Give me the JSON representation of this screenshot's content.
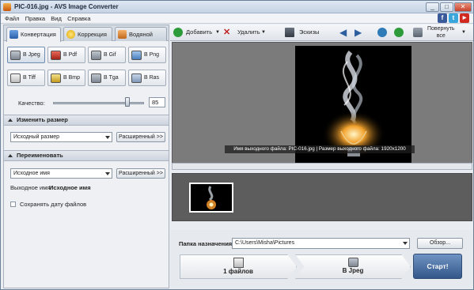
{
  "window": {
    "title": "PIC-016.jpg - AVS Image Converter",
    "min": "_",
    "max": "□",
    "close": "✕"
  },
  "menu": [
    "Файл",
    "Правка",
    "Вид",
    "Справка"
  ],
  "social": {
    "facebook": "f",
    "twitter": "t",
    "youtube": "▶"
  },
  "tabs": [
    "Конвертация",
    "Коррекция",
    "Водяной знак"
  ],
  "formats": [
    "В Jpeg",
    "В Pdf",
    "В Gif",
    "В Png",
    "В Tiff",
    "В Bmp",
    "В Tga",
    "В Ras"
  ],
  "quality": {
    "label": "Качество:",
    "value": "85",
    "level": 0.85
  },
  "resize": {
    "header": "Изменить размер",
    "select": "Исходный размер",
    "advanced": "Расширенный >>"
  },
  "rename": {
    "header": "Переименовать",
    "select": "Исходное имя",
    "advanced": "Расширенный >>",
    "output_label": "Выходное имя:",
    "output_value": "Исходное имя"
  },
  "keep_date": "Сохранять дату файлов",
  "toolbar": {
    "add": "Добавить",
    "delete": "Удалить",
    "thumbs": "Эскизы",
    "rotate_all": "Повернуть\nвсе"
  },
  "preview_caption": "Имя выходного файла: PIC-016.jpg | Размер выходного файла: 1920x1200",
  "destination": {
    "label": "Папка назначения:",
    "path": "C:\\Users\\Misha\\Pictures",
    "browse": "Обзор..."
  },
  "steps": {
    "files": "1 файлов",
    "format": "В Jpeg",
    "start": "Старт!"
  },
  "colors": {
    "accent": "#34578a",
    "panel": "#eef0f3"
  }
}
